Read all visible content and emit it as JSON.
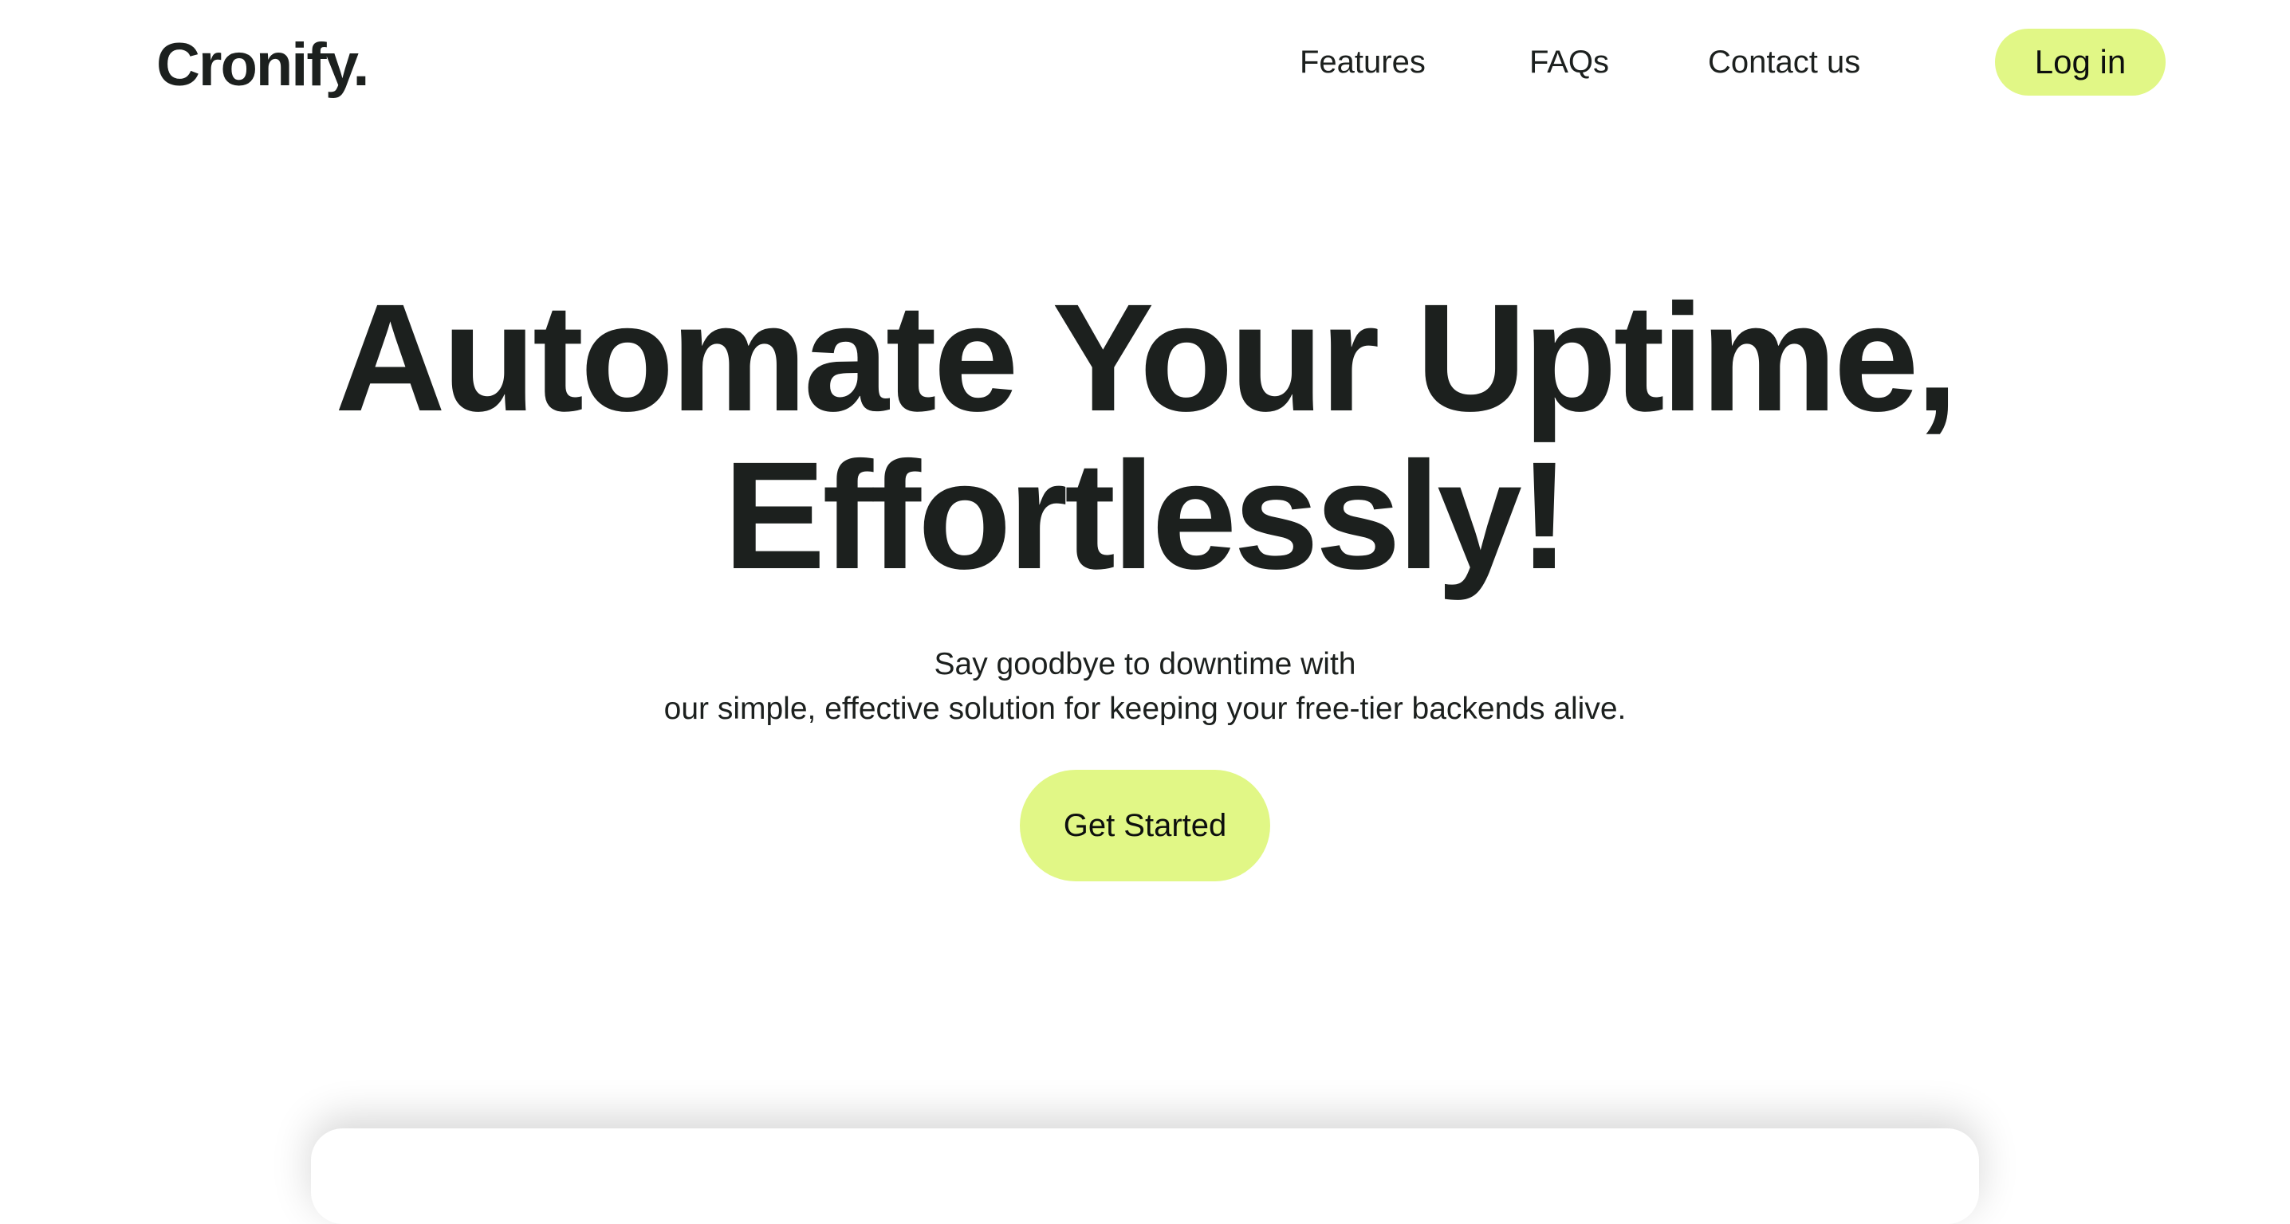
{
  "header": {
    "logo": "Cronify.",
    "nav": {
      "features": "Features",
      "faqs": "FAQs",
      "contact": "Contact us"
    },
    "login_label": "Log in"
  },
  "hero": {
    "title_line1": "Automate Your Uptime,",
    "title_line2": "Effortlessly!",
    "subtitle_line1": "Say goodbye to downtime with",
    "subtitle_line2": "our simple, effective solution for keeping your free-tier backends alive.",
    "cta_label": "Get Started"
  },
  "colors": {
    "accent": "#e1f786",
    "text": "#1c201e",
    "background": "#ffffff"
  }
}
